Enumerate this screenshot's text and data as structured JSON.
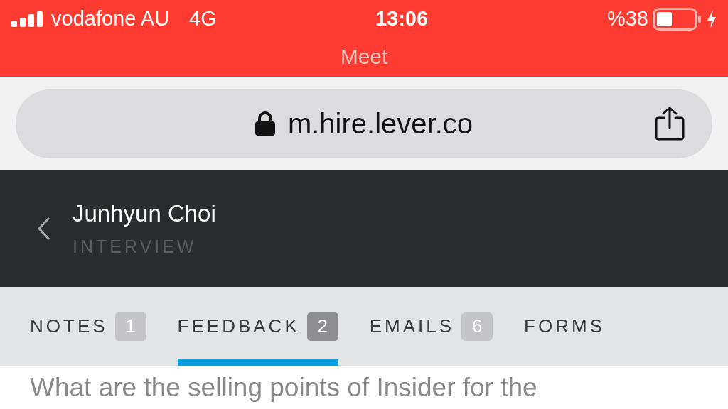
{
  "status_bar": {
    "carrier": "vodafone AU",
    "network": "4G",
    "time": "13:06",
    "battery": "%38",
    "app": "Meet"
  },
  "address_bar": {
    "url": "m.hire.lever.co"
  },
  "header": {
    "name": "Junhyun Choi",
    "stage": "INTERVIEW"
  },
  "tabs": [
    {
      "label": "NOTES",
      "count": "1",
      "selected": false
    },
    {
      "label": "FEEDBACK",
      "count": "2",
      "selected": true
    },
    {
      "label": "EMAILS",
      "count": "6",
      "selected": false
    },
    {
      "label": "FORMS",
      "selected": false
    }
  ],
  "content": {
    "question": "What are the selling points of Insider for the"
  }
}
